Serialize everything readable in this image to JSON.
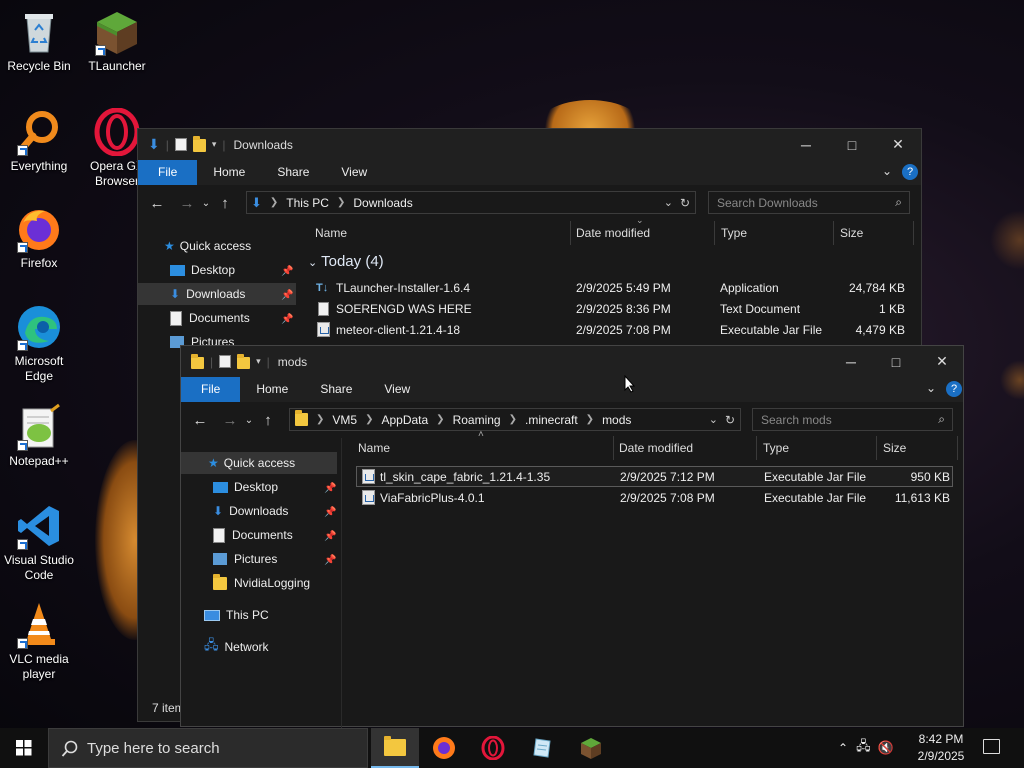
{
  "desktop": {
    "icons": [
      {
        "label": "Recycle Bin"
      },
      {
        "label": "TLauncher"
      },
      {
        "label": "Everything"
      },
      {
        "label": "Opera GX Browser"
      },
      {
        "label": "Firefox"
      },
      {
        "label": "Microsoft Edge"
      },
      {
        "label": "Notepad++"
      },
      {
        "label": "Visual Studio Code"
      },
      {
        "label": "VLC media player"
      }
    ]
  },
  "downloads_window": {
    "title": "Downloads",
    "ribbon": [
      "File",
      "Home",
      "Share",
      "View"
    ],
    "path": [
      "This PC",
      "Downloads"
    ],
    "search_placeholder": "Search Downloads",
    "nav": [
      "Quick access",
      "Desktop",
      "Downloads",
      "Documents",
      "Pictures"
    ],
    "columns": {
      "name": "Name",
      "date": "Date modified",
      "type": "Type",
      "size": "Size"
    },
    "group_label": "Today (4)",
    "files": [
      {
        "name": "TLauncher-Installer-1.6.4",
        "date": "2/9/2025 5:49 PM",
        "type": "Application",
        "size": "24,784 KB"
      },
      {
        "name": "SOERENGD WAS HERE",
        "date": "2/9/2025 8:36 PM",
        "type": "Text Document",
        "size": "1 KB"
      },
      {
        "name": "meteor-client-1.21.4-18",
        "date": "2/9/2025 7:08 PM",
        "type": "Executable Jar File",
        "size": "4,479 KB"
      }
    ],
    "status": "7 item"
  },
  "mods_window": {
    "title": "mods",
    "ribbon": [
      "File",
      "Home",
      "Share",
      "View"
    ],
    "path": [
      "VM5",
      "AppData",
      "Roaming",
      ".minecraft",
      "mods"
    ],
    "search_placeholder": "Search mods",
    "nav": {
      "quick_access": "Quick access",
      "desktop": "Desktop",
      "downloads": "Downloads",
      "documents": "Documents",
      "pictures": "Pictures",
      "nvidia": "NvidiaLogging",
      "this_pc": "This PC",
      "network": "Network"
    },
    "columns": {
      "name": "Name",
      "date": "Date modified",
      "type": "Type",
      "size": "Size"
    },
    "files": [
      {
        "name": "tl_skin_cape_fabric_1.21.4-1.35",
        "date": "2/9/2025 7:12 PM",
        "type": "Executable Jar File",
        "size": "950 KB"
      },
      {
        "name": "ViaFabricPlus-4.0.1",
        "date": "2/9/2025 7:08 PM",
        "type": "Executable Jar File",
        "size": "11,613 KB"
      }
    ]
  },
  "taskbar": {
    "search_placeholder": "Type here to search",
    "time": "8:42 PM",
    "date": "2/9/2025"
  },
  "colors": {
    "accent": "#1a6fc4",
    "window_bg": "#191919",
    "titlebar": "#202020"
  }
}
